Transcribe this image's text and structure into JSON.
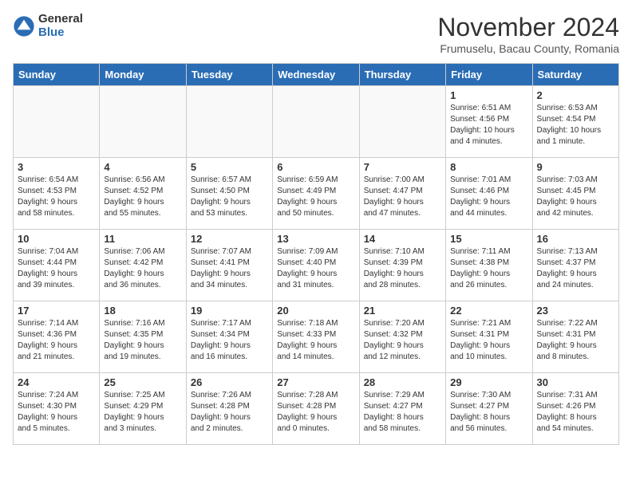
{
  "logo": {
    "general": "General",
    "blue": "Blue"
  },
  "title": "November 2024",
  "subtitle": "Frumuselu, Bacau County, Romania",
  "days_header": [
    "Sunday",
    "Monday",
    "Tuesday",
    "Wednesday",
    "Thursday",
    "Friday",
    "Saturday"
  ],
  "weeks": [
    [
      {
        "day": "",
        "info": ""
      },
      {
        "day": "",
        "info": ""
      },
      {
        "day": "",
        "info": ""
      },
      {
        "day": "",
        "info": ""
      },
      {
        "day": "",
        "info": ""
      },
      {
        "day": "1",
        "info": "Sunrise: 6:51 AM\nSunset: 4:56 PM\nDaylight: 10 hours\nand 4 minutes."
      },
      {
        "day": "2",
        "info": "Sunrise: 6:53 AM\nSunset: 4:54 PM\nDaylight: 10 hours\nand 1 minute."
      }
    ],
    [
      {
        "day": "3",
        "info": "Sunrise: 6:54 AM\nSunset: 4:53 PM\nDaylight: 9 hours\nand 58 minutes."
      },
      {
        "day": "4",
        "info": "Sunrise: 6:56 AM\nSunset: 4:52 PM\nDaylight: 9 hours\nand 55 minutes."
      },
      {
        "day": "5",
        "info": "Sunrise: 6:57 AM\nSunset: 4:50 PM\nDaylight: 9 hours\nand 53 minutes."
      },
      {
        "day": "6",
        "info": "Sunrise: 6:59 AM\nSunset: 4:49 PM\nDaylight: 9 hours\nand 50 minutes."
      },
      {
        "day": "7",
        "info": "Sunrise: 7:00 AM\nSunset: 4:47 PM\nDaylight: 9 hours\nand 47 minutes."
      },
      {
        "day": "8",
        "info": "Sunrise: 7:01 AM\nSunset: 4:46 PM\nDaylight: 9 hours\nand 44 minutes."
      },
      {
        "day": "9",
        "info": "Sunrise: 7:03 AM\nSunset: 4:45 PM\nDaylight: 9 hours\nand 42 minutes."
      }
    ],
    [
      {
        "day": "10",
        "info": "Sunrise: 7:04 AM\nSunset: 4:44 PM\nDaylight: 9 hours\nand 39 minutes."
      },
      {
        "day": "11",
        "info": "Sunrise: 7:06 AM\nSunset: 4:42 PM\nDaylight: 9 hours\nand 36 minutes."
      },
      {
        "day": "12",
        "info": "Sunrise: 7:07 AM\nSunset: 4:41 PM\nDaylight: 9 hours\nand 34 minutes."
      },
      {
        "day": "13",
        "info": "Sunrise: 7:09 AM\nSunset: 4:40 PM\nDaylight: 9 hours\nand 31 minutes."
      },
      {
        "day": "14",
        "info": "Sunrise: 7:10 AM\nSunset: 4:39 PM\nDaylight: 9 hours\nand 28 minutes."
      },
      {
        "day": "15",
        "info": "Sunrise: 7:11 AM\nSunset: 4:38 PM\nDaylight: 9 hours\nand 26 minutes."
      },
      {
        "day": "16",
        "info": "Sunrise: 7:13 AM\nSunset: 4:37 PM\nDaylight: 9 hours\nand 24 minutes."
      }
    ],
    [
      {
        "day": "17",
        "info": "Sunrise: 7:14 AM\nSunset: 4:36 PM\nDaylight: 9 hours\nand 21 minutes."
      },
      {
        "day": "18",
        "info": "Sunrise: 7:16 AM\nSunset: 4:35 PM\nDaylight: 9 hours\nand 19 minutes."
      },
      {
        "day": "19",
        "info": "Sunrise: 7:17 AM\nSunset: 4:34 PM\nDaylight: 9 hours\nand 16 minutes."
      },
      {
        "day": "20",
        "info": "Sunrise: 7:18 AM\nSunset: 4:33 PM\nDaylight: 9 hours\nand 14 minutes."
      },
      {
        "day": "21",
        "info": "Sunrise: 7:20 AM\nSunset: 4:32 PM\nDaylight: 9 hours\nand 12 minutes."
      },
      {
        "day": "22",
        "info": "Sunrise: 7:21 AM\nSunset: 4:31 PM\nDaylight: 9 hours\nand 10 minutes."
      },
      {
        "day": "23",
        "info": "Sunrise: 7:22 AM\nSunset: 4:31 PM\nDaylight: 9 hours\nand 8 minutes."
      }
    ],
    [
      {
        "day": "24",
        "info": "Sunrise: 7:24 AM\nSunset: 4:30 PM\nDaylight: 9 hours\nand 5 minutes."
      },
      {
        "day": "25",
        "info": "Sunrise: 7:25 AM\nSunset: 4:29 PM\nDaylight: 9 hours\nand 3 minutes."
      },
      {
        "day": "26",
        "info": "Sunrise: 7:26 AM\nSunset: 4:28 PM\nDaylight: 9 hours\nand 2 minutes."
      },
      {
        "day": "27",
        "info": "Sunrise: 7:28 AM\nSunset: 4:28 PM\nDaylight: 9 hours\nand 0 minutes."
      },
      {
        "day": "28",
        "info": "Sunrise: 7:29 AM\nSunset: 4:27 PM\nDaylight: 8 hours\nand 58 minutes."
      },
      {
        "day": "29",
        "info": "Sunrise: 7:30 AM\nSunset: 4:27 PM\nDaylight: 8 hours\nand 56 minutes."
      },
      {
        "day": "30",
        "info": "Sunrise: 7:31 AM\nSunset: 4:26 PM\nDaylight: 8 hours\nand 54 minutes."
      }
    ]
  ]
}
